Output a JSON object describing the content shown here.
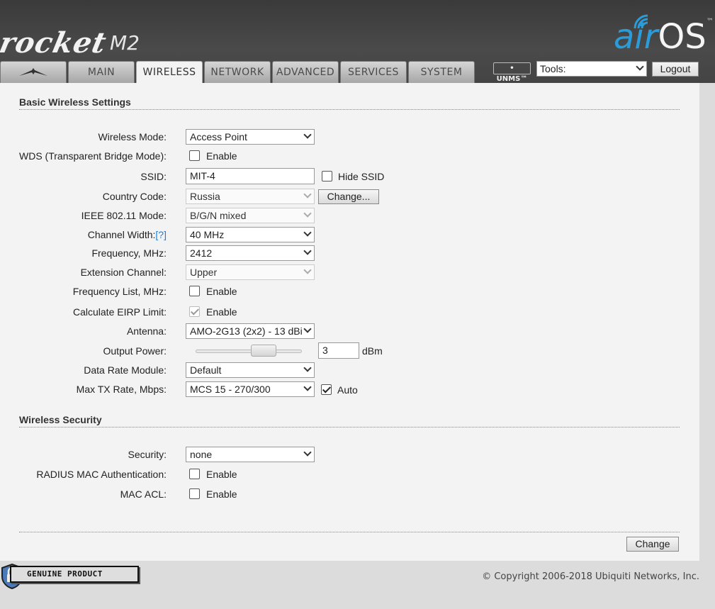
{
  "header": {
    "brand": "rocket",
    "model": "M2",
    "os_air": "air",
    "os_name": "OS",
    "os_tm": "™"
  },
  "tabs": [
    {
      "label": "",
      "icon": "ubiquiti-logo-icon"
    },
    {
      "label": "MAIN"
    },
    {
      "label": "WIRELESS",
      "active": true
    },
    {
      "label": "NETWORK"
    },
    {
      "label": "ADVANCED"
    },
    {
      "label": "SERVICES"
    },
    {
      "label": "SYSTEM"
    }
  ],
  "toolbar": {
    "unms": "• UNMS™",
    "tools_value": "Tools:",
    "logout": "Logout"
  },
  "basic": {
    "title": "Basic Wireless Settings",
    "wireless_mode_label": "Wireless Mode:",
    "wireless_mode": "Access Point",
    "wds_label": "WDS (Transparent Bridge Mode):",
    "wds_enable": "Enable",
    "ssid_label": "SSID:",
    "ssid_value": "MIT-4",
    "hide_ssid": "Hide SSID",
    "country_label": "Country Code:",
    "country_value": "Russia",
    "country_change": "Change...",
    "ieee_label": "IEEE 802.11 Mode:",
    "ieee_value": "B/G/N mixed",
    "channel_width_label": "Channel Width:",
    "channel_width_help": "[?]",
    "channel_width_value": "40 MHz",
    "frequency_label": "Frequency, MHz:",
    "frequency_value": "2412",
    "ext_channel_label": "Extension Channel:",
    "ext_channel_value": "Upper",
    "freq_list_label": "Frequency List, MHz:",
    "freq_list_enable": "Enable",
    "eirp_label": "Calculate EIRP Limit:",
    "eirp_enable": "Enable",
    "antenna_label": "Antenna:",
    "antenna_value": "AMO-2G13 (2x2) - 13 dBi",
    "output_power_label": "Output Power:",
    "output_power_value": "3",
    "output_power_unit": "dBm",
    "data_rate_label": "Data Rate Module:",
    "data_rate_value": "Default",
    "max_tx_label": "Max TX Rate, Mbps:",
    "max_tx_value": "MCS 15 - 270/300",
    "max_tx_auto": "Auto"
  },
  "security": {
    "title": "Wireless Security",
    "security_label": "Security:",
    "security_value": "none",
    "radius_label": "RADIUS MAC Authentication:",
    "radius_enable": "Enable",
    "mac_acl_label": "MAC ACL:",
    "mac_acl_enable": "Enable"
  },
  "actions": {
    "change": "Change"
  },
  "footer": {
    "badge": "GENUINE  PRODUCT",
    "copyright": "© Copyright 2006-2018 Ubiquiti Networks, Inc."
  },
  "colors": {
    "accent": "#2b9cd8",
    "header_bg": "#444444",
    "panel_bg": "#f3f3f3"
  }
}
